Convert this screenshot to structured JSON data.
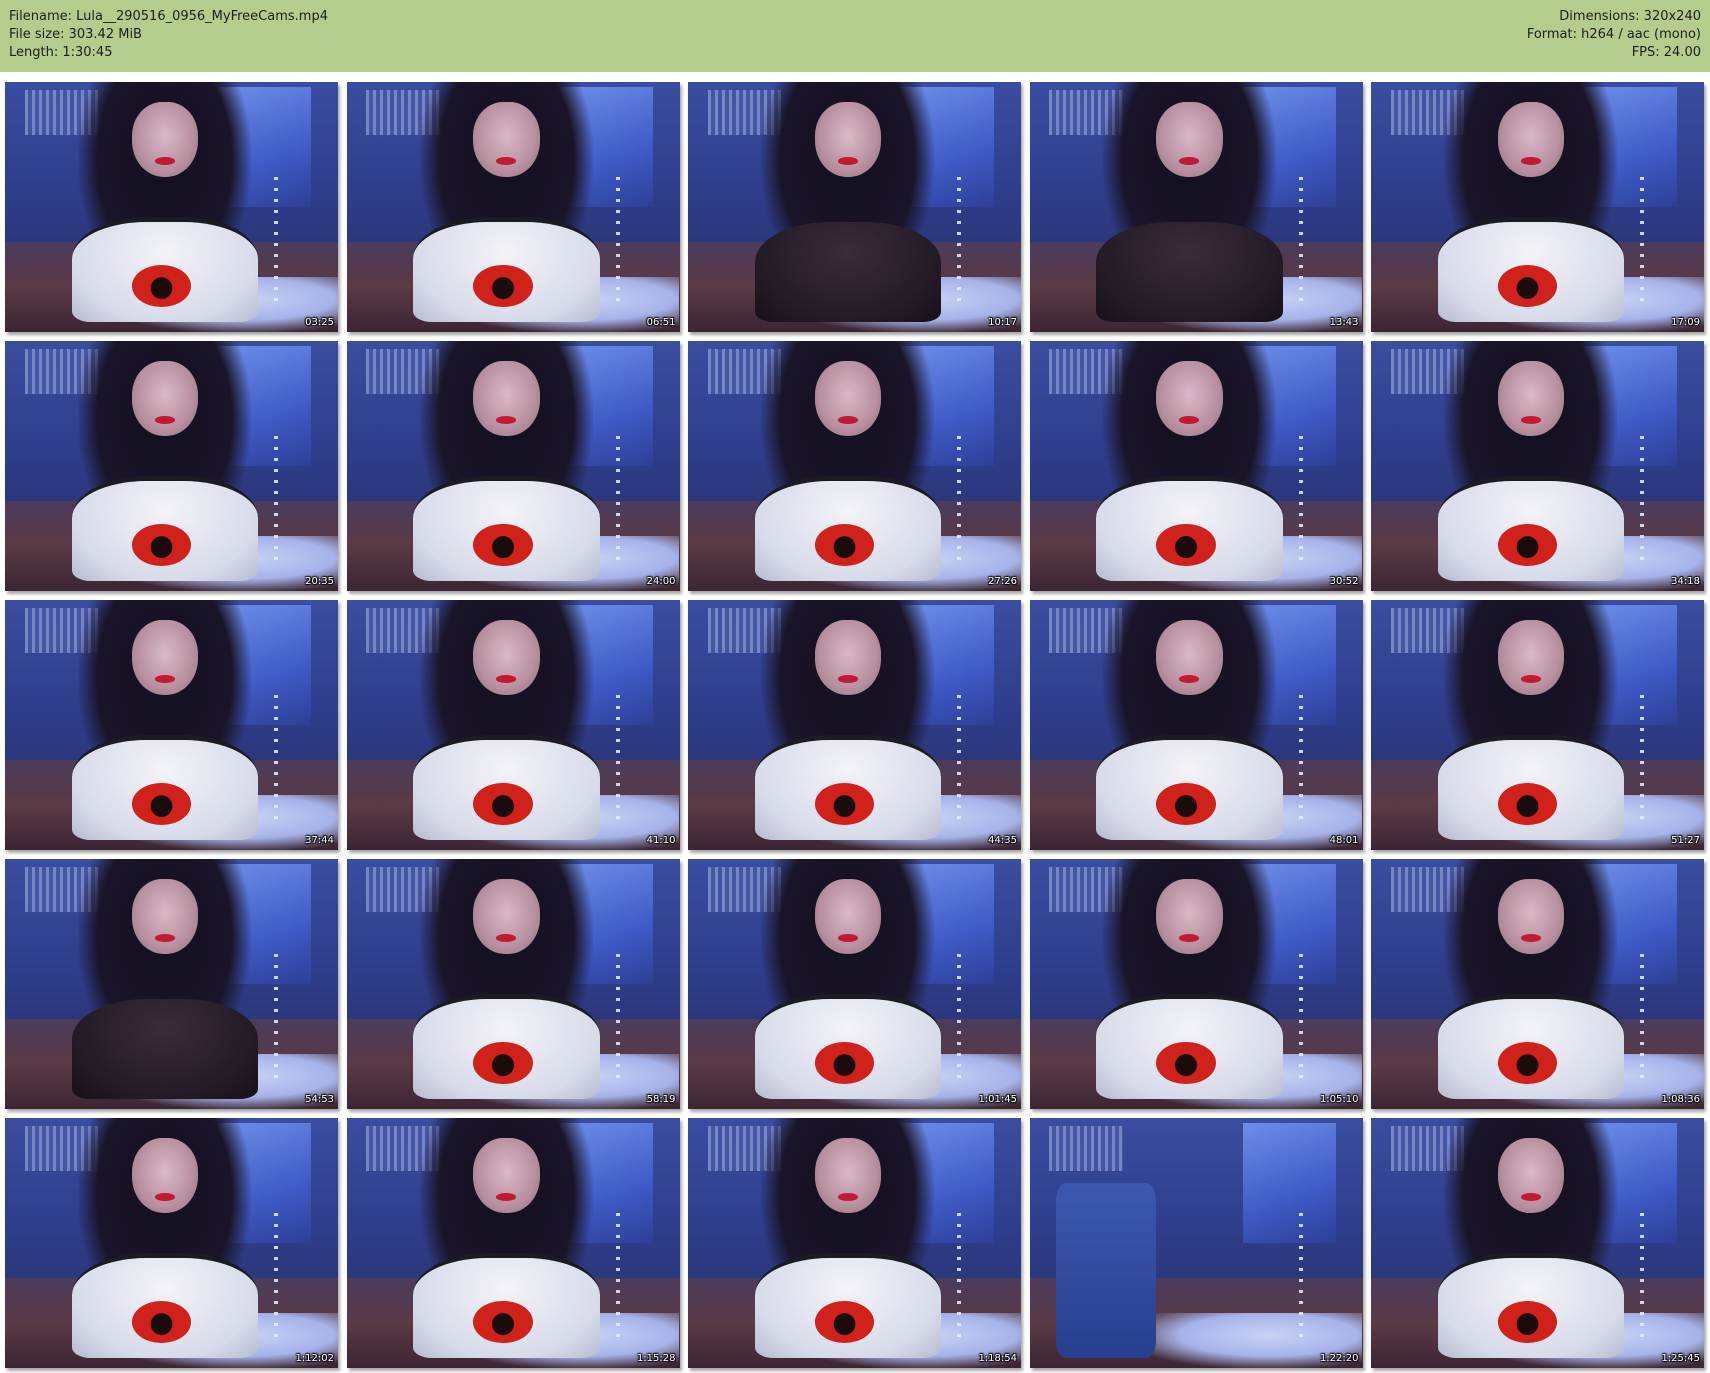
{
  "header": {
    "filename": "Filename: Lula__290516_0956_MyFreeCams.mp4",
    "filesize": "File size: 303.42 MiB",
    "length": "Length: 1:30:45",
    "dimensions": "Dimensions: 320x240",
    "format": "Format: h264 / aac (mono)",
    "fps": "FPS: 24.00"
  },
  "colors": {
    "header_background": "#b4cc8c",
    "page_background": "#ffffff",
    "timestamp_text": "#ffffff"
  },
  "thumbnails": [
    {
      "timestamp": "03:25"
    },
    {
      "timestamp": "06:51"
    },
    {
      "timestamp": "10:17"
    },
    {
      "timestamp": "13:43"
    },
    {
      "timestamp": "17:09"
    },
    {
      "timestamp": "20:35"
    },
    {
      "timestamp": "24:00"
    },
    {
      "timestamp": "27:26"
    },
    {
      "timestamp": "30:52"
    },
    {
      "timestamp": "34:18"
    },
    {
      "timestamp": "37:44"
    },
    {
      "timestamp": "41:10"
    },
    {
      "timestamp": "44:35"
    },
    {
      "timestamp": "48:01"
    },
    {
      "timestamp": "51:27"
    },
    {
      "timestamp": "54:53"
    },
    {
      "timestamp": "58:19"
    },
    {
      "timestamp": "1:01:45"
    },
    {
      "timestamp": "1:05:10"
    },
    {
      "timestamp": "1:08:36"
    },
    {
      "timestamp": "1:12:02"
    },
    {
      "timestamp": "1:15:28"
    },
    {
      "timestamp": "1:18:54"
    },
    {
      "timestamp": "1:22:20"
    },
    {
      "timestamp": "1:25:45"
    }
  ]
}
